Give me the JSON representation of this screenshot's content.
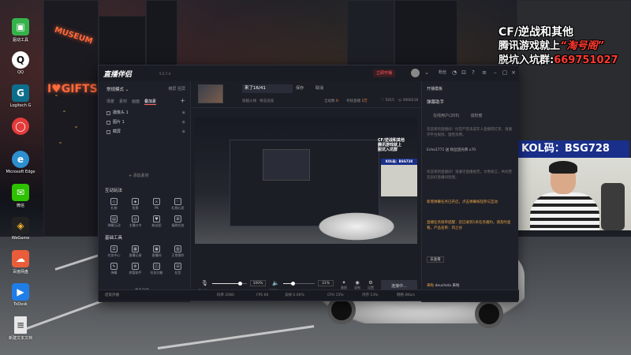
{
  "desktop": {
    "icons": [
      {
        "label": "驱动工具",
        "icon": "green-app",
        "color": "#35b34a"
      },
      {
        "label": "QQ",
        "icon": "qq-penguin",
        "color": "#1e1e1e"
      },
      {
        "label": "Logitech G",
        "icon": "logitech",
        "color": "#1b1b1b"
      },
      {
        "label": "Microsoft Edge",
        "icon": "edge-browser",
        "color": "#2d8fd0"
      },
      {
        "label": "微信",
        "icon": "wechat",
        "color": "#2dc100"
      },
      {
        "label": "WeGame",
        "icon": "wegame",
        "color": "#222"
      },
      {
        "label": "百度网盘",
        "icon": "baidu-cloud",
        "color": "#e95d3a"
      },
      {
        "label": "ToDesk",
        "icon": "todesk",
        "color": "#1f7de8"
      },
      {
        "label": "新建文本文档",
        "icon": "text-file",
        "color": "#e8e8e8"
      }
    ]
  },
  "overlay": {
    "line1": "CF/逆战和其他",
    "line2_prefix": "腾讯游戏就上",
    "line2_highlight": "“淘号阁”",
    "line3_prefix": "脱坑入坑群:",
    "line3_highlight": "669751027",
    "kol": "KOL码：BSG728"
  },
  "app": {
    "name": "直播伴侣",
    "version": "5.5.7.4",
    "titlebar": {
      "live_btn": "立即开播",
      "fans_label": "粉丝",
      "count_label": "/2万"
    },
    "left": {
      "mode": "常规模式",
      "mode_right": [
        "横屏",
        "竖屏"
      ],
      "scene_tabs": [
        "场景",
        "素材",
        "画面",
        "叠加素"
      ],
      "sources": [
        {
          "label": "摄像头 1",
          "visible": true
        },
        {
          "label": "图片 1",
          "visible": true
        },
        {
          "label": "截屏",
          "visible": true
        }
      ],
      "add_source": "+ 添加素材",
      "interaction_title": "互动玩法",
      "interaction_tools": [
        "礼物",
        "投票",
        "PK",
        "礼物心愿",
        "弹幕互动",
        "主播口令",
        "粉丝团",
        "福袋任务"
      ],
      "basic_title": "基础工具",
      "basic_tools": [
        "任务中心",
        "直播记录",
        "直播间",
        "正常操作",
        "弹幕",
        "房管助手",
        "任务功能",
        "拉货"
      ],
      "more": "更多功能"
    },
    "center": {
      "stream_title": "来了16/41",
      "save": "保存",
      "cancel": "取消",
      "category": "穿越火线 · 射击竞技",
      "stats": [
        {
          "label": "全站数",
          "value": "0"
        },
        {
          "label": "考核直播",
          "value": "1万"
        },
        {
          "label": "",
          "value": "5015"
        },
        {
          "label": "",
          "value": "3906216"
        }
      ],
      "preview_text": "CF/逆战和其他\n腾讯游戏就上\n脱坑入坑群",
      "preview_kol": "KOL码：BSG728",
      "mic_label": "麦克风",
      "mic_volume": "100%",
      "speaker_label": "扬声器",
      "speaker_volume": "31%",
      "beauty_label": "美颜",
      "record_label": "录制",
      "settings_label": "设置",
      "connect": "连接中...",
      "mic_level": 0.8,
      "speaker_level": 0.3
    },
    "right": {
      "top_left": "开播模板",
      "helper": "弹幕助手",
      "tabs": [
        "在线用户(205)",
        "谈粉度"
      ],
      "messages": [
        "欢迎来到直播间！抖音严禁未成年人直播或打赏，请遵守平台规则，理性消费。",
        "Echo1771 送 粉丝团光牌 x70",
        "欢迎来到直播间！请遵守直播规范，文明发言，共同营造良好直播间氛围。",
        "新增弹幕任务已开启，点击弹幕按钮参与互动",
        "直播任务接单提醒：您已收到1条任务邀约，请及时查看。产品名称：风之谷"
      ],
      "more": "去查看",
      "bottom_user": "来啦",
      "bottom_user2": "deuchela",
      "bottom_msg": "来啦"
    },
    "status": {
      "items": [
        "结束开播",
        "码率 2080",
        "FPS 60",
        "丢帧 0.00%",
        "CPU 15%",
        "内存 13%",
        "网络 0Kb/s"
      ]
    }
  }
}
